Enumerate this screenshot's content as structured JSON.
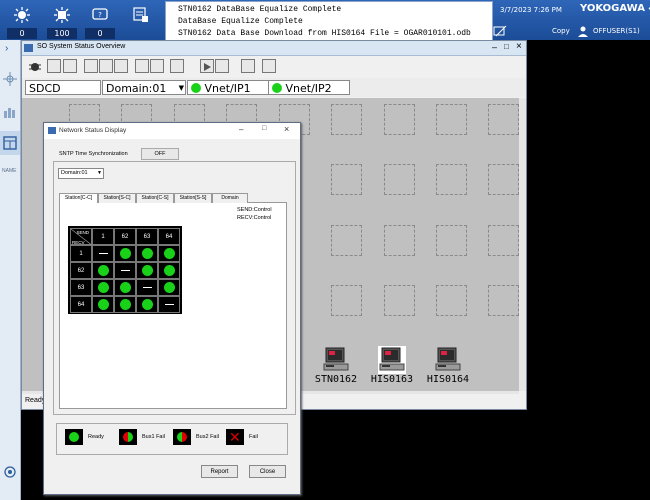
{
  "toolbar": {
    "counters": [
      "0",
      "100",
      "0",
      "0"
    ]
  },
  "messages": [
    "STN0162  DataBase Equalize Complete",
    "DataBase Equalize Complete",
    "STN0162  Data Base Download from HIS0164 File = OGAR010101.odb"
  ],
  "header_right": {
    "datetime": "3/7/2023 7:26 PM",
    "brand": "YOKOGAWA",
    "copy_label": "Copy",
    "user": "OFFUSER(S1)"
  },
  "sidebar": {
    "name_label": "NAME"
  },
  "overview": {
    "title": "SO  System Status Overview",
    "system": "SDCD",
    "domain": "Domain:01",
    "vnet1": "Vnet/IP1",
    "vnet2": "Vnet/IP2",
    "stations": [
      "STN0162",
      "HIS0163",
      "HIS0164"
    ],
    "status": "Ready"
  },
  "nsd": {
    "title": "Network Status Display",
    "sntp_label": "SNTP Time Synchronization",
    "sntp_value": "OFF",
    "domain_select": "Domain:01",
    "tabs": [
      "Station[C-C]",
      "Station[S-C]",
      "Station[C-S]",
      "Station[S-S]",
      "Domain"
    ],
    "send_control": "SEND:Control",
    "recv_control": "RECV:Control",
    "grid_corner_send": "SEND",
    "grid_corner_recv": "RECV",
    "grid_cols": [
      "1",
      "62",
      "63",
      "64"
    ],
    "grid_rows": [
      {
        "label": "1",
        "cells": [
          "dash",
          "ok",
          "ok",
          "ok"
        ]
      },
      {
        "label": "62",
        "cells": [
          "ok",
          "dash",
          "ok",
          "ok"
        ]
      },
      {
        "label": "63",
        "cells": [
          "ok",
          "ok",
          "dash",
          "ok"
        ]
      },
      {
        "label": "64",
        "cells": [
          "ok",
          "ok",
          "ok",
          "dash"
        ]
      }
    ],
    "legend": [
      "Ready",
      "Bus1 Fail",
      "Bus2 Fail",
      "Fail"
    ],
    "report_label": "Report",
    "close_label": "Close"
  },
  "colors": {
    "ok": "#1ad11a",
    "fail": "#e00000",
    "brand_blue": "#1b4c97"
  }
}
